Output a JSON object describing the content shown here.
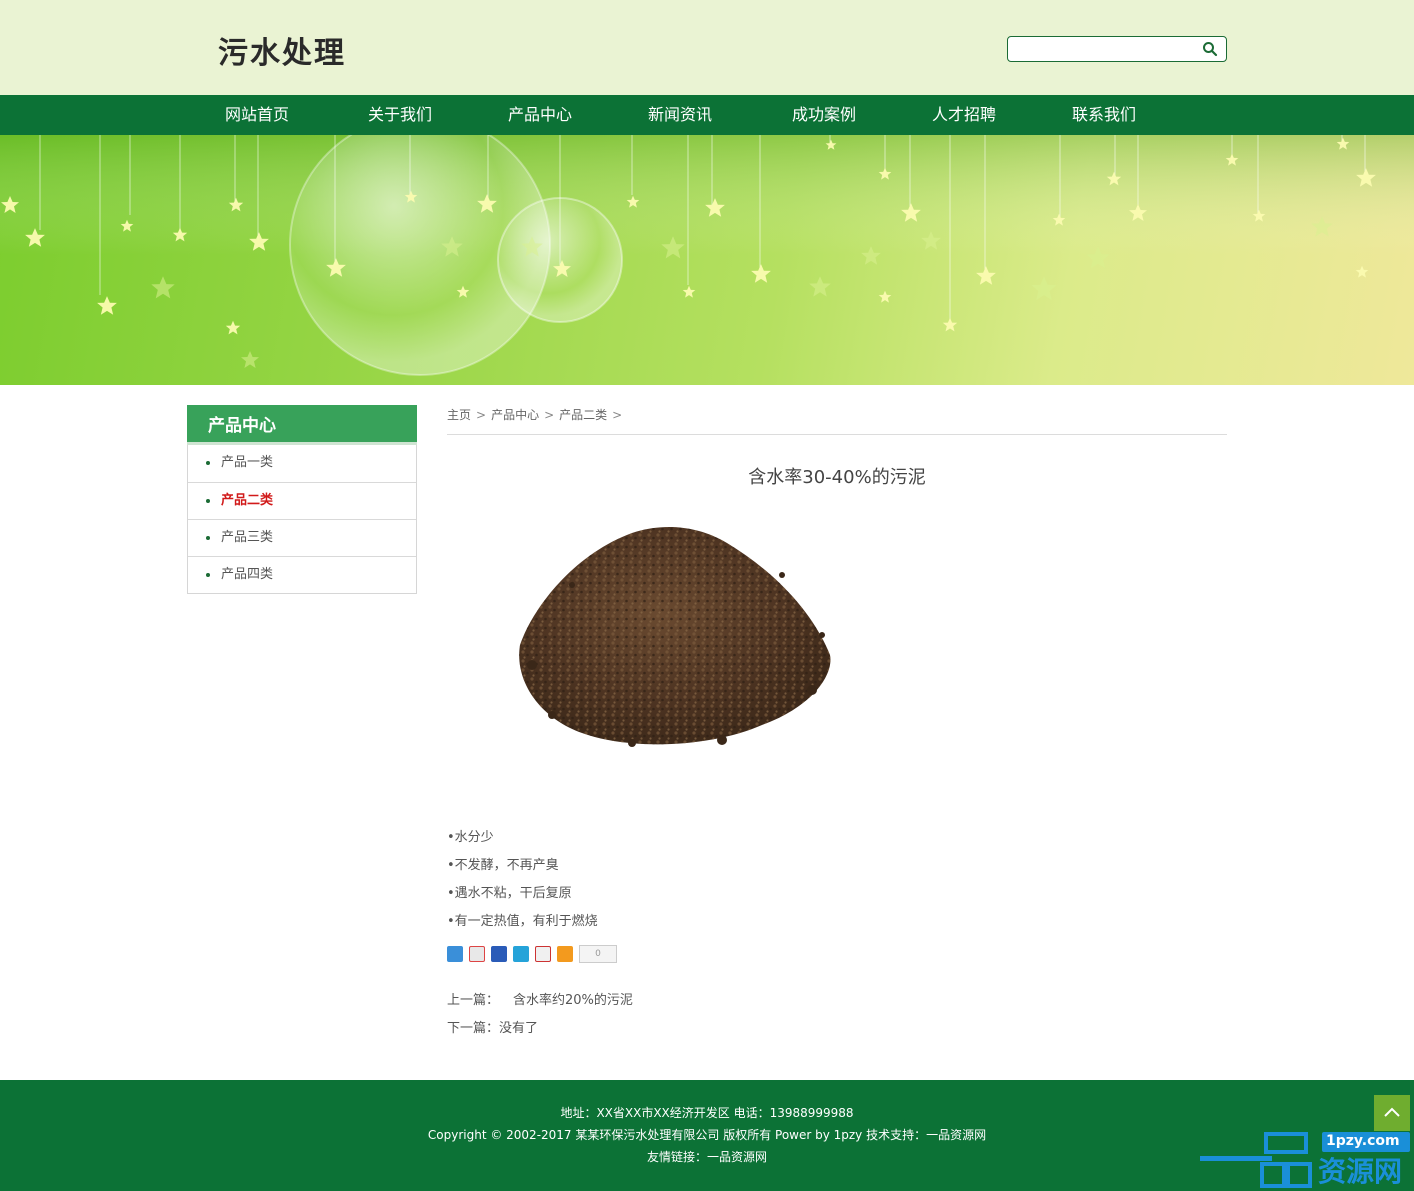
{
  "header": {
    "logo": "污水处理",
    "search": {
      "value": "",
      "placeholder": ""
    }
  },
  "nav": {
    "items": [
      "网站首页",
      "关于我们",
      "产品中心",
      "新闻资讯",
      "成功案例",
      "人才招聘",
      "联系我们"
    ]
  },
  "sidebar": {
    "title": "产品中心",
    "items": [
      "产品一类",
      "产品二类",
      "产品三类",
      "产品四类"
    ],
    "active_index": 1
  },
  "breadcrumb": {
    "items": [
      "主页",
      "产品中心",
      "产品二类"
    ],
    "separator": ">"
  },
  "article": {
    "title": "含水率30-40%的污泥",
    "features": [
      "•水分少",
      "•不发酵，不再产臭",
      "•遇水不粘，干后复原",
      "•有一定热值，有利于燃烧"
    ],
    "share_count": "0",
    "prev_label": "上一篇：",
    "prev_link": "含水率约20%的污泥",
    "next_label": "下一篇：",
    "next_value": "没有了"
  },
  "footer": {
    "address": "地址：XX省XX市XX经济开发区  电话：13988999988",
    "copyright": "Copyright © 2002-2017 某某环保污水处理有限公司 版权所有 Power by 1pzy  技术支持：一品资源网",
    "links_label": "友情链接：",
    "links": [
      "一品资源网"
    ]
  },
  "watermark": {
    "site": "1pzy.com",
    "text": "资源网"
  },
  "colors": {
    "header_bg": "#eaf3d3",
    "nav_bg": "#0c7236",
    "sidebar_title_bg": "#38a25a",
    "active_item": "#d11a1a",
    "footer_bg": "#0c7236",
    "to_top_bg": "#6fad2f"
  },
  "icons": {
    "search": "search-icon",
    "to_top": "chevron-up-icon"
  }
}
